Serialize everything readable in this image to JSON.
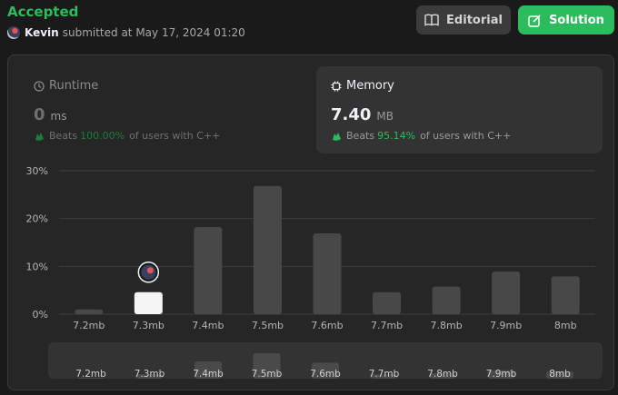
{
  "header": {
    "status": "Accepted",
    "user": "Kevin",
    "submitted_text": "submitted at May 17, 2024 01:20",
    "editorial_label": "Editorial",
    "solution_label": "Solution"
  },
  "runtime": {
    "title": "Runtime",
    "value": "0",
    "unit": "ms",
    "beats_label": "Beats",
    "beats_pct": "100.00%",
    "beats_suffix": "of users with C++"
  },
  "memory": {
    "title": "Memory",
    "value": "7.40",
    "unit": "MB",
    "beats_label": "Beats",
    "beats_pct": "95.14%",
    "beats_suffix": "of users with C++"
  },
  "colors": {
    "accent": "#2cbb5d",
    "bar": "#484848",
    "bar_selected": "#f5f5f5",
    "background": "#1a1a1a",
    "panel": "#262626"
  },
  "chart_data": {
    "type": "bar",
    "categories": [
      "7.2mb",
      "7.3mb",
      "7.4mb",
      "7.5mb",
      "7.6mb",
      "7.7mb",
      "7.8mb",
      "7.9mb",
      "8mb"
    ],
    "values": [
      1.0,
      4.6,
      18.2,
      26.8,
      16.9,
      4.6,
      5.8,
      8.9,
      7.9
    ],
    "selected_category": "7.3mb",
    "y_ticks": [
      "30%",
      "20%",
      "10%",
      "0%"
    ],
    "ylim": [
      0,
      30
    ],
    "grid": true,
    "overview": {
      "labels": [
        "7.2mb",
        "7.3mb",
        "7.4mb",
        "7.5mb",
        "7.6mb",
        "7.7mb",
        "7.8mb",
        "7.9mb",
        "8mb"
      ]
    }
  }
}
